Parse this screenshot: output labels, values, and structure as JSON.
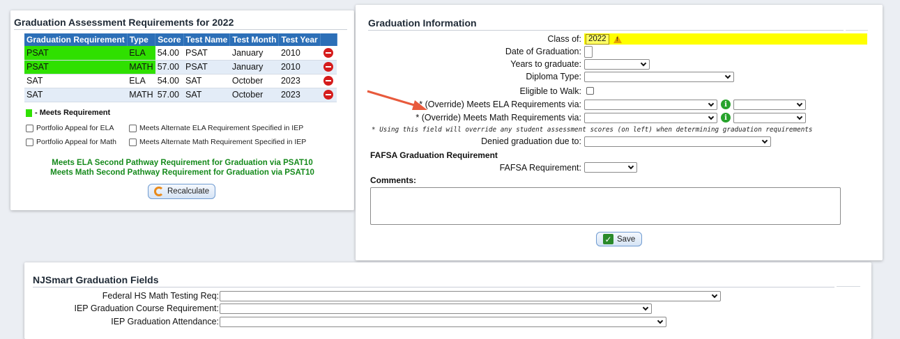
{
  "assessment": {
    "title": "Graduation Assessment Requirements for 2022",
    "columns": [
      "Graduation Requirement",
      "Type",
      "Score",
      "Test Name",
      "Test Month",
      "Test Year"
    ],
    "rows": [
      {
        "requirement": "PSAT",
        "type": "ELA",
        "score": "54.00",
        "test_name": "PSAT",
        "month": "January",
        "year": "2010",
        "meets": true
      },
      {
        "requirement": "PSAT",
        "type": "MATH",
        "score": "57.00",
        "test_name": "PSAT",
        "month": "January",
        "year": "2010",
        "meets": true
      },
      {
        "requirement": "SAT",
        "type": "ELA",
        "score": "54.00",
        "test_name": "SAT",
        "month": "October",
        "year": "2023",
        "meets": false
      },
      {
        "requirement": "SAT",
        "type": "MATH",
        "score": "57.00",
        "test_name": "SAT",
        "month": "October",
        "year": "2023",
        "meets": false
      }
    ],
    "legend_label": "- Meets Requirement",
    "legend_color": "#2fe000",
    "checkboxes": {
      "portfolio_ela": "Portfolio Appeal for ELA",
      "alt_ela": "Meets Alternate ELA Requirement Specified in IEP",
      "portfolio_math": "Portfolio Appeal for Math",
      "alt_math": "Meets Alternate Math Requirement Specified in IEP"
    },
    "pathway_ela": "Meets ELA Second Pathway Requirement for Graduation via PSAT10",
    "pathway_math": "Meets Math Second Pathway Requirement for Graduation via PSAT10",
    "recalculate_label": "Recalculate"
  },
  "graduation": {
    "title": "Graduation Information",
    "class_of_label": "Class of:",
    "class_of_value": "2022",
    "date_label": "Date of Graduation:",
    "years_label": "Years to graduate:",
    "diploma_label": "Diploma Type:",
    "eligible_label": "Eligible to Walk:",
    "ela_override_label": "* (Override) Meets ELA Requirements via:",
    "math_override_label": "* (Override) Meets Math Requirements via:",
    "override_note": "* Using this field will override any student assessment scores (on left) when determining graduation requirements",
    "denied_label": "Denied graduation due to:",
    "fafsa_heading": "FAFSA Graduation Requirement",
    "fafsa_label": "FAFSA Requirement:",
    "comments_label": "Comments:",
    "save_label": "Save"
  },
  "njsmart": {
    "title": "NJSmart Graduation Fields",
    "federal_label": "Federal HS Math Testing Req:",
    "iep_course_label": "IEP Graduation Course Requirement:",
    "iep_attendance_label": "IEP Graduation Attendance:"
  },
  "colors": {
    "header_blue": "#2c6fb7",
    "meets_green": "#2fe000",
    "pathway_text": "#168a1c",
    "highlight_yellow": "#ffff00",
    "arrow_red": "#e85a3c"
  }
}
